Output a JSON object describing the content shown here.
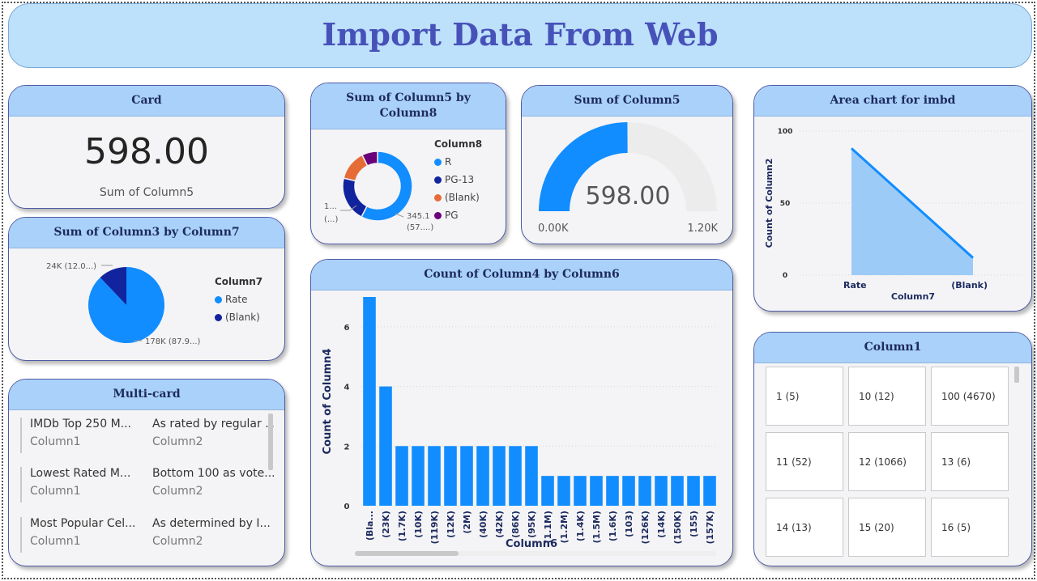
{
  "page_title": "Import Data From Web",
  "colors": {
    "accent": "#118dff",
    "navy": "#12239e",
    "orange": "#e66c37",
    "purple": "#6b007b",
    "header": "#a9d1fa"
  },
  "card": {
    "title": "Card",
    "value": "598.00",
    "label": "Sum of Column5"
  },
  "pie": {
    "title": "Sum of Column3 by Column7",
    "legend_title": "Column7",
    "legend": [
      "Rate",
      "(Blank)"
    ],
    "label_small": "24K (12.0...)",
    "label_large": "178K (87.9...)"
  },
  "multicard": {
    "title": "Multi-card",
    "rows": [
      {
        "v1": "IMDb Top 250 M...",
        "l1": "Column1",
        "v2": "As rated by regular ...",
        "l2": "Column2"
      },
      {
        "v1": "Lowest Rated M...",
        "l1": "Column1",
        "v2": "Bottom 100 as vote...",
        "l2": "Column2"
      },
      {
        "v1": "Most Popular Cel...",
        "l1": "Column1",
        "v2": "As determined by I...",
        "l2": "Column2"
      }
    ]
  },
  "donut": {
    "title": "Sum of Column5 by Column8",
    "legend_title": "Column8",
    "legend": [
      "R",
      "PG-13",
      "(Blank)",
      "PG"
    ],
    "label_left_1": "1...",
    "label_left_2": "(...)",
    "label_right_1": "345.1",
    "label_right_2": "(57....)"
  },
  "gauge": {
    "title": "Sum of Column5",
    "value": "598.00",
    "min_label": "0.00K",
    "max_label": "1.20K"
  },
  "area": {
    "title": "Area chart for imbd",
    "ylabel": "Count of Column2",
    "xlabel": "Column7",
    "y_ticks": [
      "100",
      "50",
      "0"
    ],
    "x_ticks": [
      "Rate",
      "(Blank)"
    ]
  },
  "bar": {
    "title": "Count of Column4 by Column6",
    "xlabel": "Column6",
    "ylabel": "Count of Column4",
    "y_ticks": [
      "0",
      "2",
      "4",
      "6"
    ]
  },
  "column1": {
    "title": "Column1",
    "tiles": [
      "1 (5)",
      "10 (12)",
      "100 (4670)",
      "11 (52)",
      "12 (1066)",
      "13 (6)",
      "14 (13)",
      "15 (20)",
      "16 (5)"
    ]
  },
  "chart_data": [
    {
      "type": "bar",
      "title": "Count of Column4 by Column6",
      "xlabel": "Column6",
      "ylabel": "Count of Column4",
      "categories": [
        "(Bla...",
        "(23K)",
        "(1.7K)",
        "(10K)",
        "(119K)",
        "(12K)",
        "(2M)",
        "(40K)",
        "(42K)",
        "(86K)",
        "(95K)",
        "(1.1M)",
        "(1.2M)",
        "(1.4K)",
        "(1.5M)",
        "(1.6K)",
        "(103)",
        "(126K)",
        "(14K)",
        "(150K)",
        "(155)",
        "(157K)"
      ],
      "values": [
        7,
        4,
        2,
        2,
        2,
        2,
        2,
        2,
        2,
        2,
        2,
        1,
        1,
        1,
        1,
        1,
        1,
        1,
        1,
        1,
        1,
        1
      ],
      "ylim": [
        0,
        7
      ],
      "grid": true
    },
    {
      "type": "area",
      "title": "Area chart for imbd",
      "xlabel": "Column7",
      "ylabel": "Count of Column2",
      "categories": [
        "Rate",
        "(Blank)"
      ],
      "values": [
        88,
        12
      ],
      "ylim": [
        0,
        100
      ],
      "grid": true
    },
    {
      "type": "pie",
      "title": "Sum of Column3 by Column7",
      "categories": [
        "Rate",
        "(Blank)"
      ],
      "values": [
        87.9,
        12.1
      ]
    },
    {
      "type": "pie",
      "title": "Sum of Column5 by Column8",
      "categories": [
        "R",
        "PG-13",
        "(Blank)",
        "PG"
      ],
      "values": [
        57.7,
        21,
        14,
        7.3
      ]
    },
    {
      "type": "gauge",
      "title": "Sum of Column5",
      "value": 598,
      "min": 0,
      "max": 1200
    }
  ]
}
